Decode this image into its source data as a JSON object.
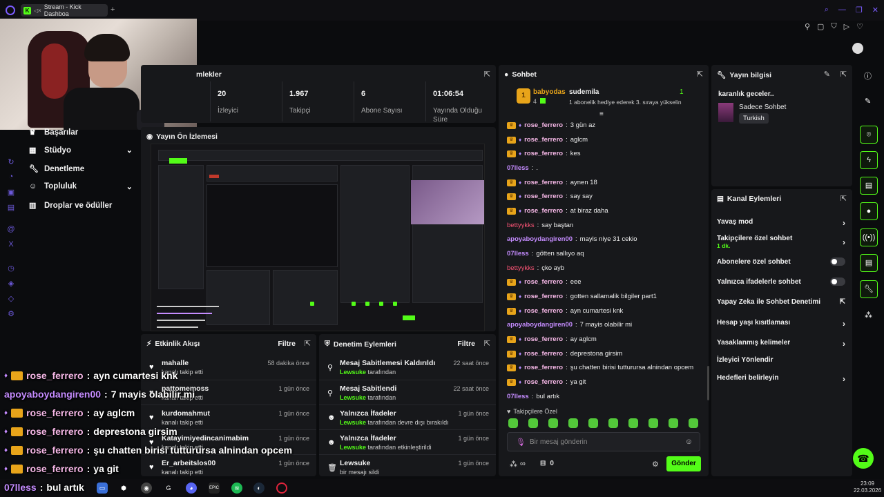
{
  "browser": {
    "tab_title": "Stream - Kick Dashboa",
    "favicon": "K",
    "new_tab": "+",
    "icons": [
      "search-icon",
      "minimize-icon",
      "restore-icon",
      "close-icon",
      "heart-icon"
    ]
  },
  "nav": {
    "items": [
      {
        "label": "Başarılar",
        "icon": "trophy-icon"
      },
      {
        "label": "Stüdyo",
        "icon": "studio-icon",
        "chevron": "⌄"
      },
      {
        "label": "Denetleme",
        "icon": "wrench-icon"
      },
      {
        "label": "Topluluk",
        "icon": "community-icon",
        "chevron": "⌄"
      },
      {
        "label": "Droplar ve ödüller",
        "icon": "drops-icon"
      }
    ]
  },
  "stats": {
    "title": "Metrikler",
    "title_visible": "mlekler",
    "items": [
      {
        "value": "20",
        "label": "İzleyici"
      },
      {
        "value": "1.967",
        "label": "Takipçi"
      },
      {
        "value": "6",
        "label": "Abone Sayısı"
      },
      {
        "value": "01:06:54",
        "label": "Yayında Olduğu Süre"
      }
    ]
  },
  "preview": {
    "title": "Yayın Ön İzlemesi"
  },
  "activity": {
    "title": "Etkinlik Akışı",
    "filter": "Filtre",
    "rows": [
      {
        "name": "mahalle",
        "sub": "kanalı takip etti",
        "time": "58 dakika önce"
      },
      {
        "name": "pattomemoss",
        "sub": "kanalı takip etti",
        "time": "1 gün önce"
      },
      {
        "name": "kurdomahmut",
        "sub": "kanalı takip etti",
        "time": "1 gün önce"
      },
      {
        "name": "Katayimiyedincanimabim",
        "sub": "kanalı takip etti",
        "time": "1 gün önce"
      },
      {
        "name": "Er_arbeitslos00",
        "sub": "kanalı takip etti",
        "time": "1 gün önce"
      }
    ]
  },
  "moderation": {
    "title": "Denetim Eylemleri",
    "filter": "Filtre",
    "rows": [
      {
        "title": "Mesaj Sabitlemesi Kaldırıldı",
        "by": "Lewsuke",
        "rest": "tarafından",
        "time": "22 saat önce",
        "icon": "unpin-icon"
      },
      {
        "title": "Mesaj Sabitlendi",
        "by": "Lewsuke",
        "rest": "tarafından",
        "time": "22 saat önce",
        "icon": "pin-icon"
      },
      {
        "title": "Yalnızca İfadeler",
        "by": "Lewsuke",
        "rest": "tarafından devre dışı bırakıldı",
        "time": "1 gün önce",
        "icon": "emote-icon"
      },
      {
        "title": "Yalnızca İfadeler",
        "by": "Lewsuke",
        "rest": "tarafından etkinleştirildi",
        "time": "1 gün önce",
        "icon": "emote-icon"
      },
      {
        "title": "Lewsuke",
        "by": "",
        "rest": "bir mesajı sildi",
        "time": "1 gün önce",
        "icon": "trash-icon"
      }
    ]
  },
  "chat": {
    "title": "Sohbet",
    "pinned": {
      "user1": "babyodas",
      "count": "4",
      "user2": "sudemila",
      "num": "1",
      "gift_text": "1 abonelik hediye ederek 3. sıraya yükselin",
      "rank": "1"
    },
    "messages": [
      {
        "user": "rose_ferrero",
        "text": "3 gün az",
        "style": "rose",
        "crown": true
      },
      {
        "user": "rose_ferrero",
        "text": "aglcm",
        "style": "rose",
        "crown": true
      },
      {
        "user": "rose_ferrero",
        "text": "kes",
        "style": "rose",
        "crown": true
      },
      {
        "user": "07lless",
        "text": ".",
        "style": "purple",
        "crown": false
      },
      {
        "user": "rose_ferrero",
        "text": "aynen 18",
        "style": "rose",
        "crown": true
      },
      {
        "user": "rose_ferrero",
        "text": "say say",
        "style": "rose",
        "crown": true
      },
      {
        "user": "rose_ferrero",
        "text": "at biraz daha",
        "style": "rose",
        "crown": true
      },
      {
        "user": "bettyykks",
        "text": "say baştan",
        "style": "red",
        "crown": false
      },
      {
        "user": "apoyaboydangiren00",
        "text": "mayis niye 31 cekio",
        "style": "purple",
        "crown": false
      },
      {
        "user": "07lless",
        "text": "götten sallıyo aq",
        "style": "purple",
        "crown": false
      },
      {
        "user": "bettyykks",
        "text": "çko ayb",
        "style": "red",
        "crown": false
      },
      {
        "user": "rose_ferrero",
        "text": "eee",
        "style": "rose",
        "crown": true
      },
      {
        "user": "rose_ferrero",
        "text": "gotten sallamalik bilgiler part1",
        "style": "rose",
        "crown": true
      },
      {
        "user": "rose_ferrero",
        "text": "ayn cumartesi knk",
        "style": "rose",
        "crown": true
      },
      {
        "user": "apoyaboydangiren00",
        "text": "7 mayis olabilir mi",
        "style": "purple",
        "crown": false
      },
      {
        "user": "rose_ferrero",
        "text": "ay aglcm",
        "style": "rose",
        "crown": true
      },
      {
        "user": "rose_ferrero",
        "text": "deprestona girsim",
        "style": "rose",
        "crown": true
      },
      {
        "user": "rose_ferrero",
        "text": "şu chatten birisi tutturursa alnindan opcem",
        "style": "rose",
        "crown": true
      },
      {
        "user": "rose_ferrero",
        "text": "ya git",
        "style": "rose",
        "crown": true
      },
      {
        "user": "07lless",
        "text": "bul artık",
        "style": "purple",
        "crown": false
      }
    ],
    "followers_only": "Takipçilere Özel",
    "input_placeholder": "Bir mesaj gönderin",
    "points": "∞",
    "gift_count": "0",
    "send": "Gönder"
  },
  "stream_info": {
    "title": "Yayın bilgisi",
    "stream_title": "karanlık geceler..",
    "category": "Sadece Sohbet",
    "language": "Turkish"
  },
  "channel_actions": {
    "title": "Kanal Eylemleri",
    "rows": [
      {
        "label": "Yavaş mod",
        "kind": "chevron"
      },
      {
        "label": "Takipçilere özel sohbet",
        "sub": "1 dk.",
        "kind": "chevron"
      },
      {
        "label": "Abonelere özel sohbet",
        "kind": "toggle"
      },
      {
        "label": "Yalnızca ifadelerle sohbet",
        "kind": "toggle"
      },
      {
        "label": "Yapay Zeka ile Sohbet Denetimi",
        "kind": "external"
      },
      {
        "label": "Hesap yaşı kısıtlaması",
        "kind": "chevron"
      },
      {
        "label": "Yasaklanmış kelimeler",
        "kind": "chevron"
      },
      {
        "label": "İzleyici Yönlendir",
        "kind": "none"
      },
      {
        "label": "Hedefleri belirleyin",
        "kind": "chevron"
      }
    ]
  },
  "overlay_chat": [
    {
      "user": "rose_ferrero",
      "text": "ayn cumartesi knk",
      "style": "rose",
      "crown": true
    },
    {
      "user": "apoyaboydangiren00",
      "text": "7 mayis olabilir mi",
      "style": "purple",
      "crown": false
    },
    {
      "user": "rose_ferrero",
      "text": "ay aglcm",
      "style": "rose",
      "crown": true
    },
    {
      "user": "rose_ferrero",
      "text": "deprestona girsim",
      "style": "rose",
      "crown": true
    },
    {
      "user": "rose_ferrero",
      "text": "şu chatten birisi tutturursa alnindan opcem",
      "style": "rose",
      "crown": true
    },
    {
      "user": "rose_ferrero",
      "text": "ya git",
      "style": "rose",
      "crown": true
    },
    {
      "user": "07lless",
      "text": "bul artık",
      "style": "purple",
      "crown": false
    }
  ],
  "taskbar": {
    "clock_time": "23:09",
    "clock_date": "22.03.2026",
    "apps": [
      "explorer-icon",
      "monitor-icon",
      "epic-icon",
      "obs-icon",
      "g-icon",
      "discord-icon",
      "epic-games-icon",
      "spotify-icon",
      "steam-icon",
      "opera-icon"
    ]
  },
  "colors": {
    "accent": "#53fc18",
    "brand_purple": "#7b5cff"
  }
}
